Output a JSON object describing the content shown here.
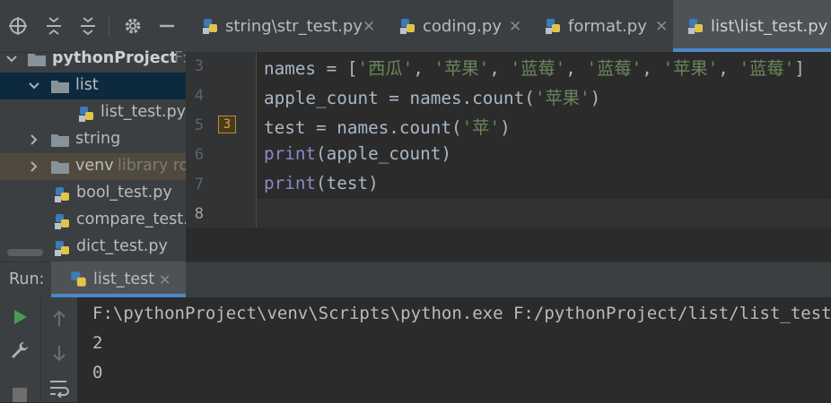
{
  "sidebar": {
    "toolbar_icons": [
      "crosshair-icon",
      "expand-all-icon",
      "collapse-all-icon",
      "gear-icon",
      "hide-icon"
    ],
    "tree": [
      {
        "label": "pythonProject",
        "suffix": "F:",
        "type": "root-folder",
        "expanded": true
      },
      {
        "label": "list",
        "type": "folder",
        "expanded": true,
        "selected": true
      },
      {
        "label": "list_test.py",
        "type": "python-file"
      },
      {
        "label": "string",
        "type": "folder",
        "expanded": false
      },
      {
        "label": "venv",
        "suffix": "library ro",
        "type": "folder",
        "expanded": false,
        "excluded": true
      },
      {
        "label": "bool_test.py",
        "type": "python-file"
      },
      {
        "label": "compare_test.p",
        "type": "python-file"
      },
      {
        "label": "dict_test.py",
        "type": "python-file"
      }
    ]
  },
  "editor": {
    "tabs": [
      {
        "label": "string\\str_test.py",
        "close": "✕"
      },
      {
        "label": "coding.py",
        "close": "✕"
      },
      {
        "label": "format.py",
        "close": "✕"
      },
      {
        "label": "list\\list_test.py",
        "active": true
      }
    ],
    "line_numbers": [
      "3",
      "4",
      "5",
      "6",
      "7",
      "8"
    ],
    "fold_marker": "3",
    "code": {
      "l3": {
        "a": "names = [",
        "s1": "'西瓜'",
        "c1": ", ",
        "s2": "'苹果'",
        "c2": ", ",
        "s3": "'蓝莓'",
        "c3": ", ",
        "s4": "'蓝莓'",
        "c4": ", ",
        "s5": "'苹果'",
        "c5": ", ",
        "s6": "'蓝莓'",
        "b": "]"
      },
      "l4": {
        "a": "apple_count = names.count(",
        "s": "'苹果'",
        "b": ")"
      },
      "l5": {
        "a": "test = names.count(",
        "s": "'苹'",
        "b": ")"
      },
      "l6": {
        "kw": "print",
        "b": "(apple_count)"
      },
      "l7": {
        "kw": "print",
        "b": "(test)"
      }
    },
    "colors": {
      "keyword": "#8888c6",
      "string": "#6a8759",
      "text": "#a9b7c6",
      "accent": "#4a88c7"
    }
  },
  "run_panel": {
    "title": "Run:",
    "tab_label": "list_test",
    "tab_close": "✕",
    "side_icons": [
      "run-icon",
      "wrench-icon",
      "stop-icon",
      "up-arrow-icon",
      "down-arrow-icon",
      "soft-wrap-icon"
    ],
    "console_lines": [
      "F:\\pythonProject\\venv\\Scripts\\python.exe F:/pythonProject/list/list_test.py",
      "2",
      "0"
    ]
  }
}
